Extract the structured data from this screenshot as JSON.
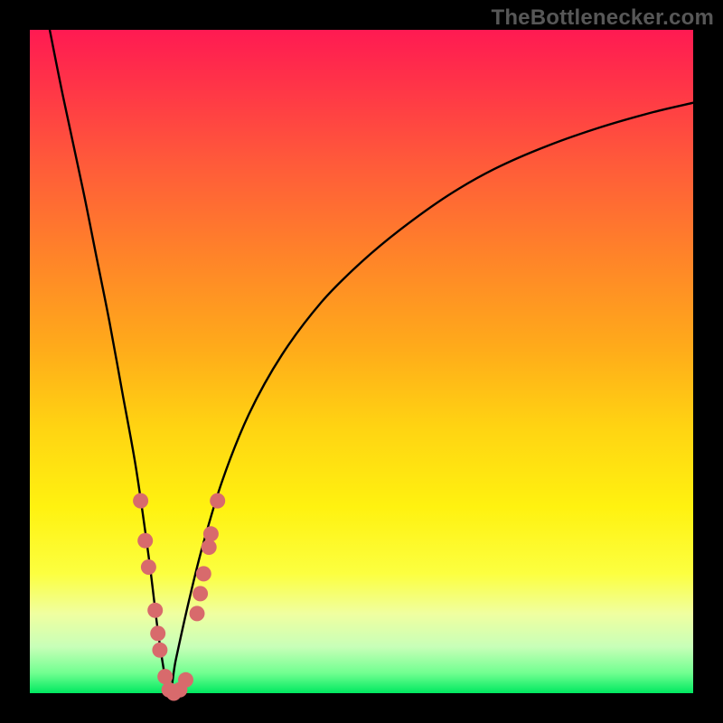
{
  "attribution": "TheBottlenecker.com",
  "chart_data": {
    "type": "line",
    "title": "",
    "xlabel": "",
    "ylabel": "",
    "xlim": [
      0,
      100
    ],
    "ylim": [
      0,
      100
    ],
    "x_optimum": 21,
    "series": [
      {
        "name": "bottleneck-curve",
        "x": [
          3,
          5,
          8,
          10,
          12,
          14,
          16,
          18,
          19.5,
          21,
          22,
          24,
          26,
          29,
          33,
          38,
          44,
          50,
          56,
          63,
          70,
          78,
          86,
          94,
          100
        ],
        "values": [
          100,
          90,
          76,
          66,
          56,
          45,
          34,
          20,
          8,
          0,
          5,
          14,
          22,
          32,
          42,
          51,
          59,
          65,
          70,
          75,
          79,
          82.5,
          85.3,
          87.6,
          89
        ]
      }
    ],
    "markers": {
      "name": "sample-points",
      "color": "#d86a6c",
      "points": [
        {
          "x": 16.7,
          "y": 29
        },
        {
          "x": 17.4,
          "y": 23
        },
        {
          "x": 17.9,
          "y": 19
        },
        {
          "x": 18.9,
          "y": 12.5
        },
        {
          "x": 19.3,
          "y": 9
        },
        {
          "x": 19.6,
          "y": 6.5
        },
        {
          "x": 20.4,
          "y": 2.5
        },
        {
          "x": 21.0,
          "y": 0.5
        },
        {
          "x": 21.7,
          "y": 0
        },
        {
          "x": 22.6,
          "y": 0.5
        },
        {
          "x": 23.5,
          "y": 2
        },
        {
          "x": 25.2,
          "y": 12
        },
        {
          "x": 25.7,
          "y": 15
        },
        {
          "x": 26.2,
          "y": 18
        },
        {
          "x": 27.0,
          "y": 22
        },
        {
          "x": 27.3,
          "y": 24
        },
        {
          "x": 28.3,
          "y": 29
        }
      ]
    }
  }
}
